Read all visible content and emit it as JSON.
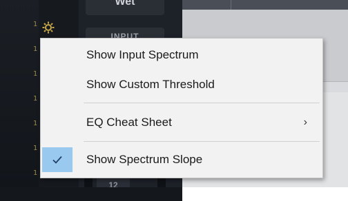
{
  "background": {
    "top_button_label": "Wet",
    "input_button_label": "INPUT",
    "fader_value": "12",
    "scale_marks": [
      "1",
      "1",
      "1",
      "1",
      "1",
      "1",
      "1"
    ]
  },
  "context_menu": {
    "items": [
      {
        "label": "Show Input Spectrum",
        "checked": false,
        "has_submenu": false
      },
      {
        "label": "Show Custom Threshold",
        "checked": false,
        "has_submenu": false
      },
      {
        "label": "EQ Cheat Sheet",
        "checked": false,
        "has_submenu": true,
        "submenu_glyph": "›"
      },
      {
        "label": "Show Spectrum Slope",
        "checked": true,
        "has_submenu": false
      }
    ]
  },
  "colors": {
    "menu_background": "#f2f2f2",
    "check_highlight": "#99c9ef",
    "gear_accent": "#c8a94a"
  },
  "icons": {
    "settings": "gear-icon",
    "check": "checkmark-icon",
    "submenu": "chevron-right-icon"
  }
}
